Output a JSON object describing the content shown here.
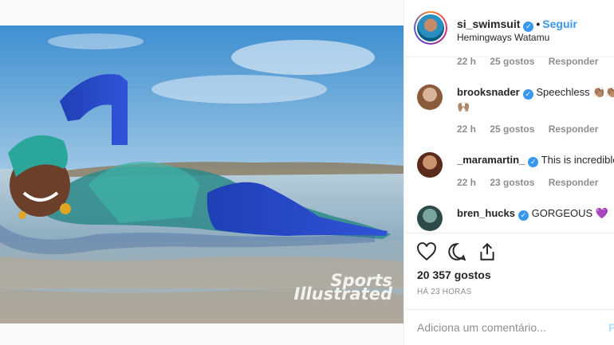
{
  "header": {
    "username": "si_swimsuit",
    "separator": "•",
    "follow_label": "Seguir",
    "location": "Hemingways Watamu"
  },
  "media": {
    "watermark_line1": "Sports",
    "watermark_line2": "Illustrated"
  },
  "comments": [
    {
      "meta": {
        "time": "22 h",
        "likes": "25 gostos",
        "reply": "Responder"
      }
    },
    {
      "username": "brooksnader",
      "text": "Speechless",
      "emoji_line": "🙌🏽",
      "meta": {
        "time": "22 h",
        "likes": "25 gostos",
        "reply": "Responder"
      }
    },
    {
      "username": "_maramartin_",
      "text": "This is incredible",
      "meta": {
        "time": "22 h",
        "likes": "23 gostos",
        "reply": "Responder"
      }
    },
    {
      "username": "bren_hucks",
      "text": "GORGEOUS 💜"
    }
  ],
  "post": {
    "likes": "20 357 gostos",
    "time_ago": "HÁ 23 HORAS"
  },
  "add_comment": {
    "placeholder": "Adiciona um comentário...",
    "publish_label": "P"
  },
  "icons": [
    "heart-icon",
    "comment-icon",
    "share-icon",
    "verified-icon"
  ],
  "colors": {
    "accent": "#3897f0",
    "muted": "#8e8e8e",
    "text": "#262626"
  }
}
